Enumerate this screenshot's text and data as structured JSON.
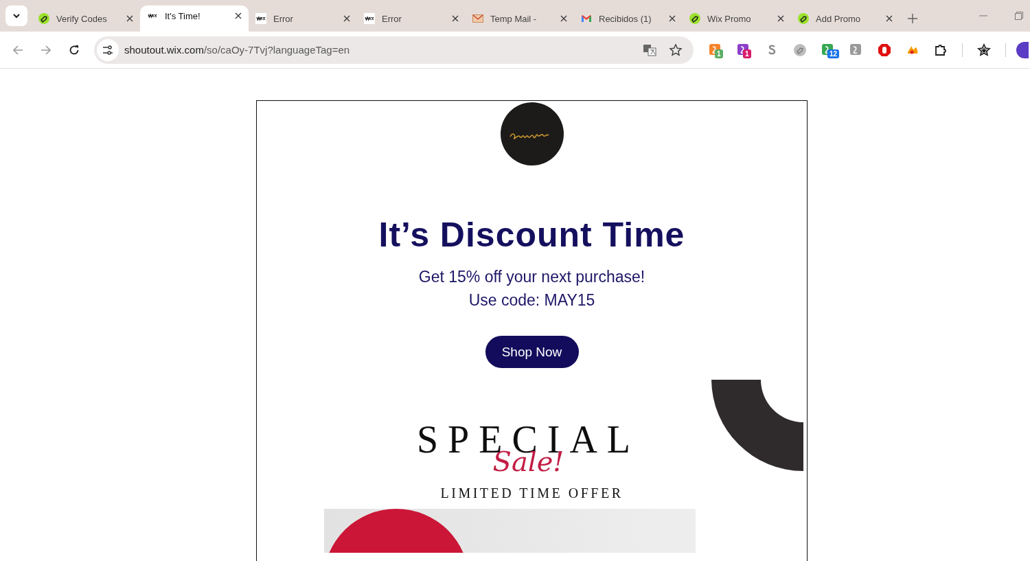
{
  "tabs": [
    {
      "kind": "coupon",
      "title": "Verify Codes",
      "selected": false
    },
    {
      "kind": "wix",
      "title": "It's Time!",
      "selected": true
    },
    {
      "kind": "wix",
      "title": "Error",
      "selected": false
    },
    {
      "kind": "wix",
      "title": "Error",
      "selected": false
    },
    {
      "kind": "mail",
      "title": "Temp Mail -",
      "selected": false
    },
    {
      "kind": "gmail",
      "title": "Recibidos (1)",
      "selected": false
    },
    {
      "kind": "coupon",
      "title": "Wix Promo",
      "selected": false
    },
    {
      "kind": "coupon",
      "title": "Add Promo",
      "selected": false
    }
  ],
  "address_bar": {
    "host": "shoutout.wix.com",
    "path": "/so/caOy-7Tvj?languageTag=en"
  },
  "extensions": [
    {
      "kind": "app",
      "color": "#f5842b",
      "badge": "1"
    },
    {
      "kind": "app",
      "color": "#8c3fc9",
      "badge": "1"
    },
    {
      "kind": "letter",
      "color": "#8a8a8a"
    },
    {
      "kind": "coupon",
      "color": "#bdbdbd"
    },
    {
      "kind": "app",
      "color": "#36a852",
      "badge": "12"
    },
    {
      "kind": "app",
      "color": "#9a9a9a"
    },
    {
      "kind": "stop",
      "color": "#e01010"
    },
    {
      "kind": "fire",
      "color": "#f59b00"
    },
    {
      "kind": "puzzle",
      "color": "#1f1f1f"
    }
  ],
  "email": {
    "heading": "It’s Discount Time",
    "lines": [
      "Get 15% off your next purchase!",
      "Use code: MAY15"
    ],
    "button": "Shop Now",
    "banner": {
      "title": "SPECIAL",
      "script": "Sale!",
      "tagline": "LIMITED TIME OFFER"
    }
  }
}
